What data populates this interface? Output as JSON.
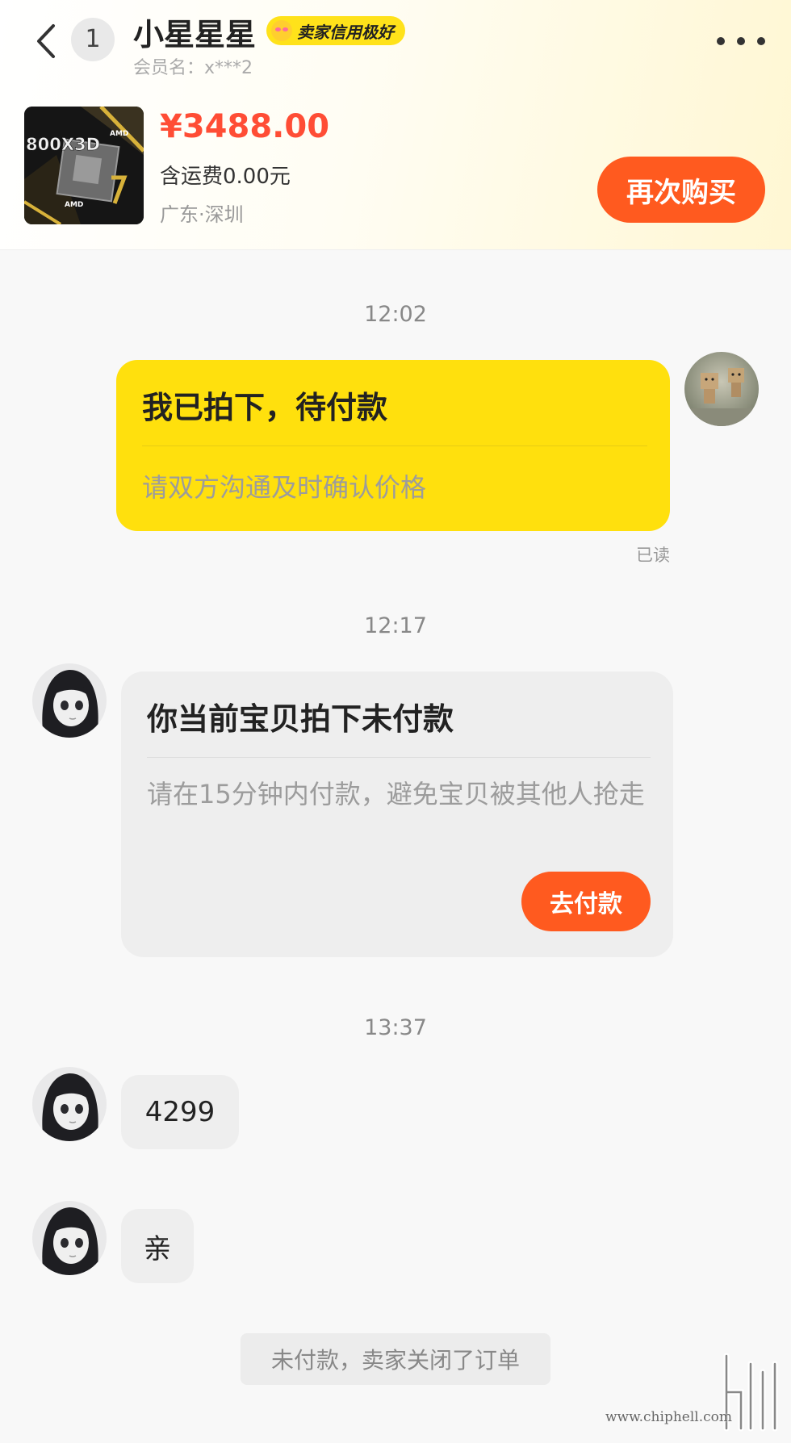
{
  "header": {
    "unread_count": "1",
    "seller_name": "小星星星",
    "credit_badge": "卖家信用极好",
    "member_label": "会员名：x***2"
  },
  "product": {
    "price": "¥3488.00",
    "shipping": "含运费0.00元",
    "location": "广东·深圳",
    "rebuy_label": "再次购买"
  },
  "messages": {
    "time_1": "12:02",
    "order_card": {
      "title": "我已拍下，待付款",
      "subtitle": "请双方沟通及时确认价格"
    },
    "read_status": "已读",
    "time_2": "12:17",
    "payment_card": {
      "title": "你当前宝贝拍下未付款",
      "subtitle": "请在15分钟内付款，避免宝贝被其他人抢走",
      "button_label": "去付款"
    },
    "time_3": "13:37",
    "text_1": "4299",
    "text_2": "亲",
    "system_notice": "未付款，卖家关闭了订单"
  },
  "watermark": {
    "url": "www.chiphell.com"
  },
  "colors": {
    "accent_orange": "#ff5a1f",
    "price_red": "#ff4d35",
    "card_yellow": "#ffe00d",
    "badge_yellow": "#ffe21a"
  }
}
